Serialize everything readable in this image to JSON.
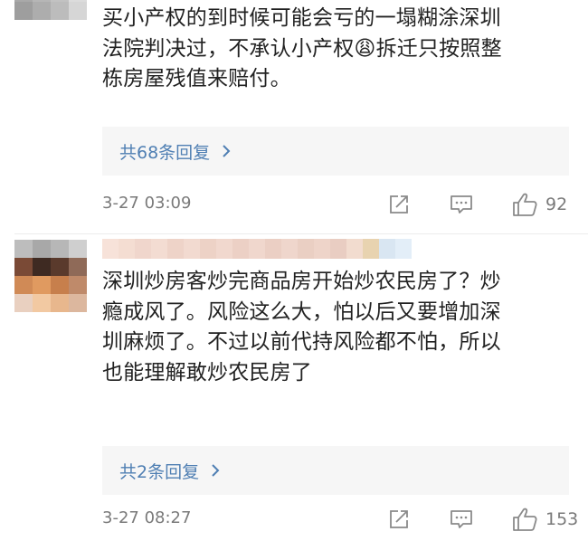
{
  "comments": [
    {
      "text": "买小产权的到时候可能会亏的一塌糊涂深圳\n法院判决过，不承认小产权😩拆迁只按照整\n栋房屋残值来赔付。",
      "reply_label": "共68条回复",
      "time": "3-27 03:09",
      "likes": "92",
      "avatar_colors": [
        "#c9c9c9",
        "#bdbdbd",
        "#d4d4d4",
        "#e6e6e6",
        "#b8b8b8",
        "#c4c4c4",
        "#d0d0d0",
        "#e2e2e2",
        "#a9a9a9",
        "#b6b6b6",
        "#c2c2c2",
        "#dcdcdc",
        "#9e9e9e",
        "#adadad",
        "#bcbcbc",
        "#d6d6d6"
      ],
      "username_colors": []
    },
    {
      "text": "深圳炒房客炒完商品房开始炒农民房了？炒\n瘾成风了。风险这么大，怕以后又要增加深\n圳麻烦了。不过以前代持风险都不怕，所以\n也能理解敢炒农民房了",
      "reply_label": "共2条回复",
      "time": "3-27 08:27",
      "likes": "153",
      "avatar_colors": [
        "#bdbdbd",
        "#a8a8a8",
        "#b7b7b7",
        "#cfcfcf",
        "#7a4a36",
        "#3e2a22",
        "#5a3a2c",
        "#8f6a58",
        "#d08a56",
        "#e09a60",
        "#c77f4c",
        "#bf8a6a",
        "#e9d0c0",
        "#f2c9a2",
        "#e8b78d",
        "#dcb79e"
      ],
      "username_colors": [
        "#f7e2d9",
        "#f4ddd2",
        "#f0d6cc",
        "#f3dcd2",
        "#eed3c8",
        "#f2dad0",
        "#edd2c6",
        "#f1d8ce",
        "#ecd0c5",
        "#f0d7cd",
        "#ebcfc4",
        "#efd6cc",
        "#eacfc3",
        "#eed4c9",
        "#e9cdc2",
        "#f2dccf",
        "#e8d3b0",
        "#d9e6f2",
        "#e3eef8"
      ]
    }
  ],
  "icons": {
    "share": "share-icon",
    "reply": "reply-icon",
    "like": "thumbs-up-icon",
    "chevron": "chevron-right-icon"
  },
  "colors": {
    "link": "#4f7fb3",
    "meta": "#7a7a7a",
    "reply_bg": "#f6f6f6",
    "text": "#222222"
  }
}
